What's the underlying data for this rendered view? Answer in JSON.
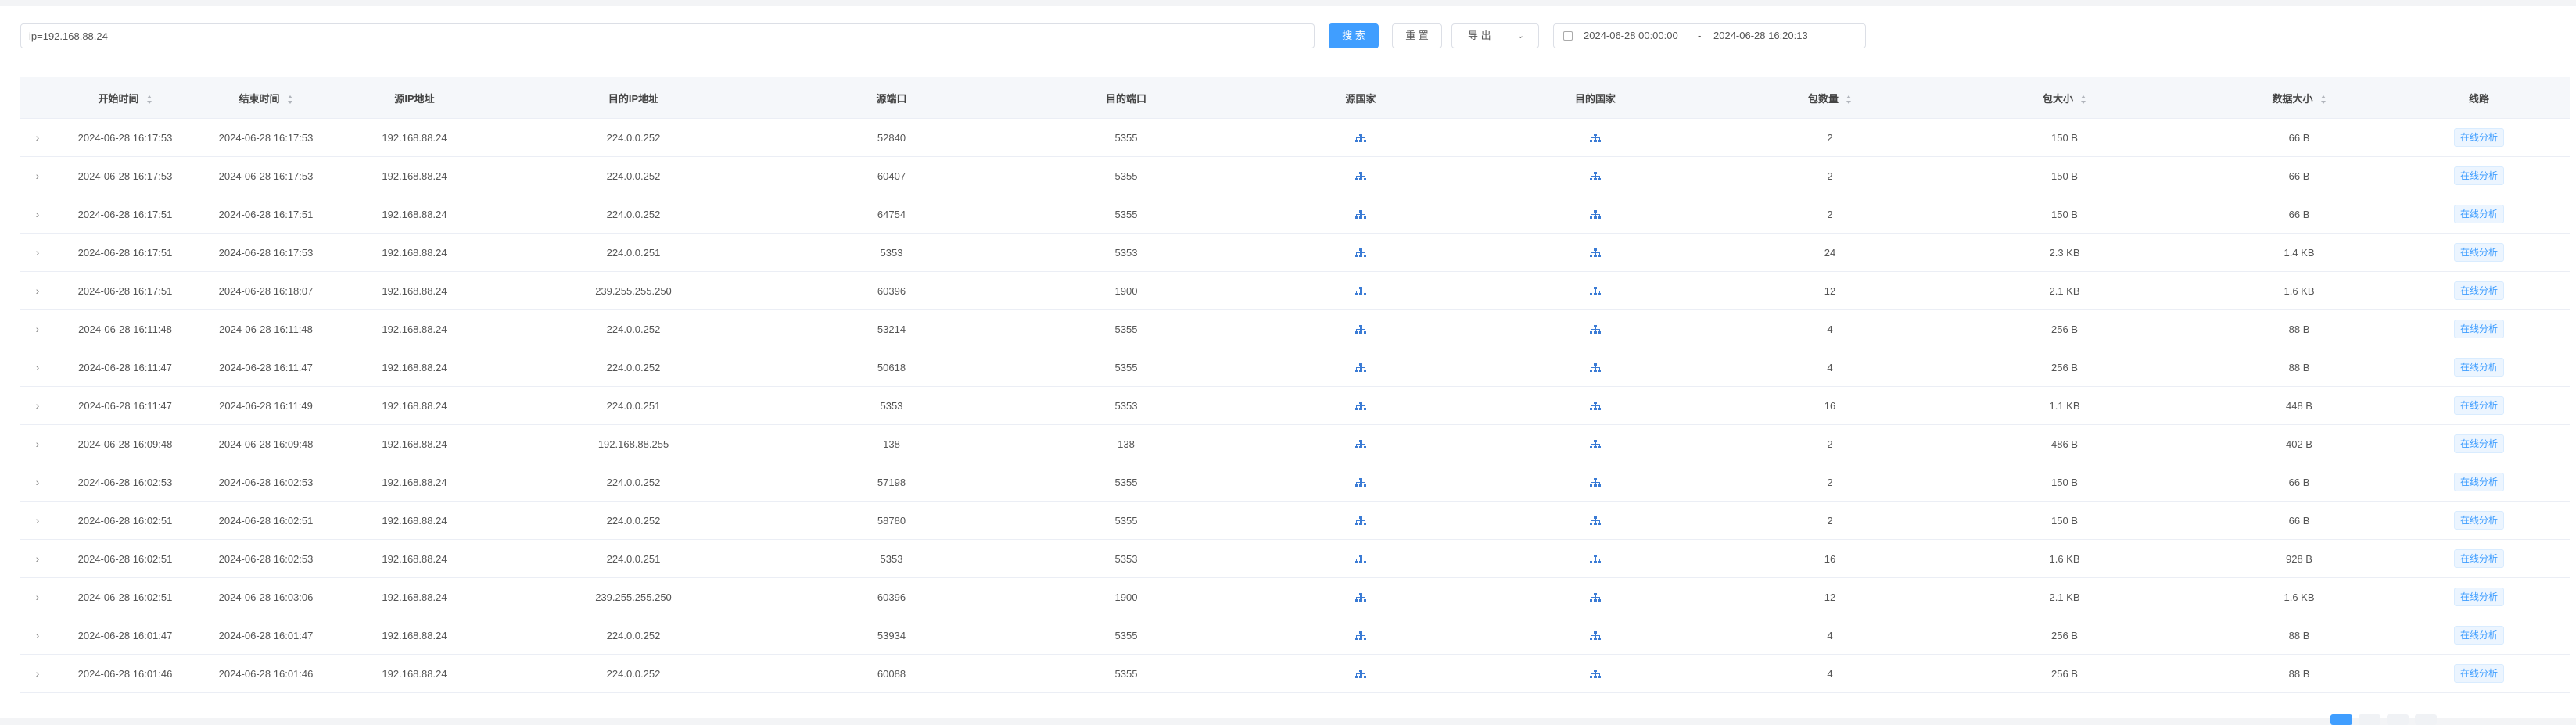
{
  "search": {
    "value": "ip=192.168.88.24"
  },
  "toolbar": {
    "search_label": "搜 索",
    "reset_label": "重 置",
    "export_label": "导 出"
  },
  "date_range": {
    "start": "2024-06-28 00:00:00",
    "separator": "-",
    "end": "2024-06-28 16:20:13"
  },
  "columns": [
    "开始时间",
    "结束时间",
    "源IP地址",
    "目的IP地址",
    "源端口",
    "目的端口",
    "源国家",
    "目的国家",
    "包数量",
    "包大小",
    "数据大小",
    "线路"
  ],
  "action_label": "在线分析",
  "accent": "#409eff",
  "rows": [
    [
      "2024-06-28 16:17:53",
      "2024-06-28 16:17:53",
      "192.168.88.24",
      "224.0.0.252",
      "52840",
      "5355",
      "2",
      "150 B",
      "66 B"
    ],
    [
      "2024-06-28 16:17:53",
      "2024-06-28 16:17:53",
      "192.168.88.24",
      "224.0.0.252",
      "60407",
      "5355",
      "2",
      "150 B",
      "66 B"
    ],
    [
      "2024-06-28 16:17:51",
      "2024-06-28 16:17:51",
      "192.168.88.24",
      "224.0.0.252",
      "64754",
      "5355",
      "2",
      "150 B",
      "66 B"
    ],
    [
      "2024-06-28 16:17:51",
      "2024-06-28 16:17:53",
      "192.168.88.24",
      "224.0.0.251",
      "5353",
      "5353",
      "24",
      "2.3 KB",
      "1.4 KB"
    ],
    [
      "2024-06-28 16:17:51",
      "2024-06-28 16:18:07",
      "192.168.88.24",
      "239.255.255.250",
      "60396",
      "1900",
      "12",
      "2.1 KB",
      "1.6 KB"
    ],
    [
      "2024-06-28 16:11:48",
      "2024-06-28 16:11:48",
      "192.168.88.24",
      "224.0.0.252",
      "53214",
      "5355",
      "4",
      "256 B",
      "88 B"
    ],
    [
      "2024-06-28 16:11:47",
      "2024-06-28 16:11:47",
      "192.168.88.24",
      "224.0.0.252",
      "50618",
      "5355",
      "4",
      "256 B",
      "88 B"
    ],
    [
      "2024-06-28 16:11:47",
      "2024-06-28 16:11:49",
      "192.168.88.24",
      "224.0.0.251",
      "5353",
      "5353",
      "16",
      "1.1 KB",
      "448 B"
    ],
    [
      "2024-06-28 16:09:48",
      "2024-06-28 16:09:48",
      "192.168.88.24",
      "192.168.88.255",
      "138",
      "138",
      "2",
      "486 B",
      "402 B"
    ],
    [
      "2024-06-28 16:02:53",
      "2024-06-28 16:02:53",
      "192.168.88.24",
      "224.0.0.252",
      "57198",
      "5355",
      "2",
      "150 B",
      "66 B"
    ],
    [
      "2024-06-28 16:02:51",
      "2024-06-28 16:02:51",
      "192.168.88.24",
      "224.0.0.252",
      "58780",
      "5355",
      "2",
      "150 B",
      "66 B"
    ],
    [
      "2024-06-28 16:02:51",
      "2024-06-28 16:02:53",
      "192.168.88.24",
      "224.0.0.251",
      "5353",
      "5353",
      "16",
      "1.6 KB",
      "928 B"
    ],
    [
      "2024-06-28 16:02:51",
      "2024-06-28 16:03:06",
      "192.168.88.24",
      "239.255.255.250",
      "60396",
      "1900",
      "12",
      "2.1 KB",
      "1.6 KB"
    ],
    [
      "2024-06-28 16:01:47",
      "2024-06-28 16:01:47",
      "192.168.88.24",
      "224.0.0.252",
      "53934",
      "5355",
      "4",
      "256 B",
      "88 B"
    ],
    [
      "2024-06-28 16:01:46",
      "2024-06-28 16:01:46",
      "192.168.88.24",
      "224.0.0.252",
      "60088",
      "5355",
      "4",
      "256 B",
      "88 B"
    ]
  ]
}
